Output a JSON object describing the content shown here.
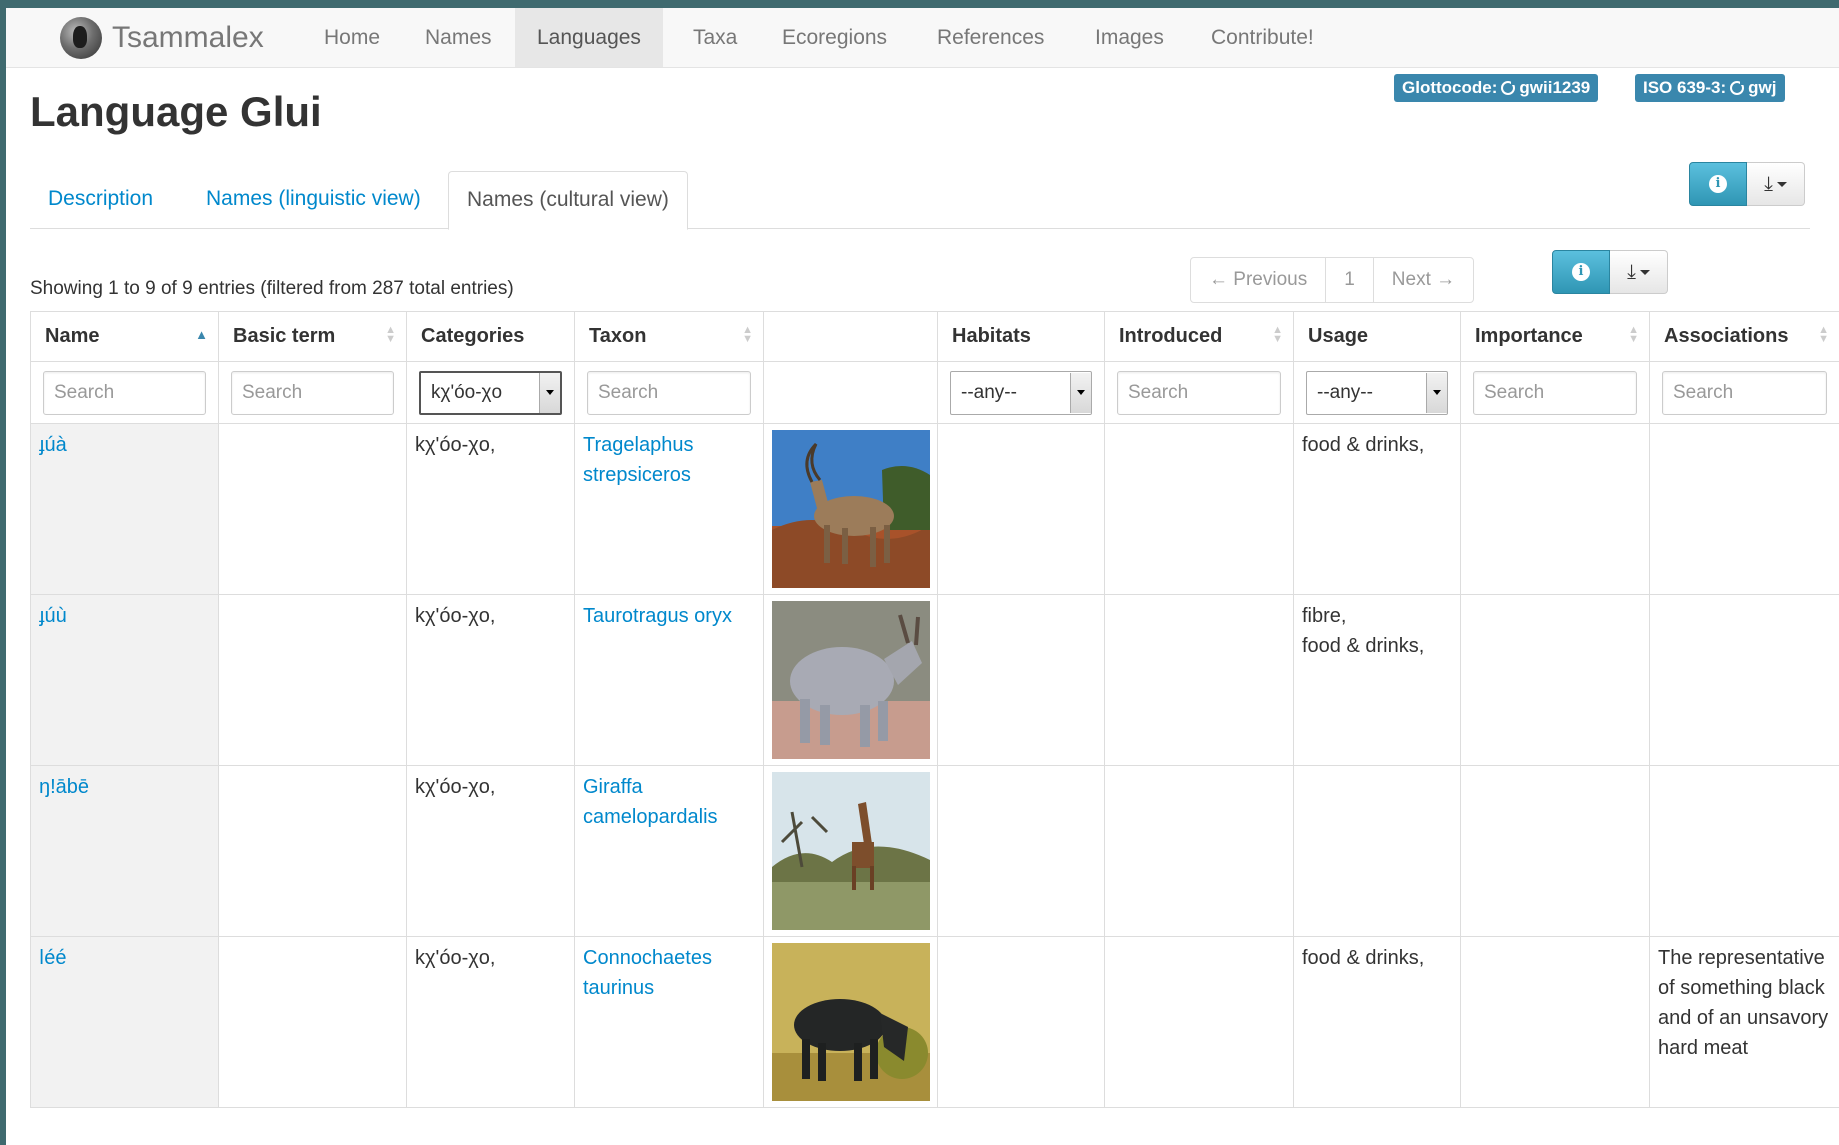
{
  "brand": "Tsammalex",
  "nav": [
    "Home",
    "Names",
    "Languages",
    "Taxa",
    "Ecoregions",
    "References",
    "Images",
    "Contribute!"
  ],
  "page_title": "Language Glui",
  "badges": {
    "glottocode_label": "Glottocode:",
    "glottocode_value": "gwii1239",
    "iso_label": "ISO 639-3:",
    "iso_value": "gwj"
  },
  "tabs": [
    "Description",
    "Names (linguistic view)",
    "Names (cultural view)"
  ],
  "showing": "Showing 1 to 9 of 9 entries (filtered from 287 total entries)",
  "pager": {
    "previous": "← Previous",
    "page": "1",
    "next": "Next →"
  },
  "columns": [
    "Name",
    "Basic term",
    "Categories",
    "Taxon",
    "",
    "Habitats",
    "Introduced",
    "Usage",
    "Importance",
    "Associations"
  ],
  "filters": {
    "search_placeholder": "Search",
    "categories_value": "kχ'óo-χo",
    "any_value": "--any--"
  },
  "rows": [
    {
      "name": "ɟúà",
      "basic": "",
      "categories": "kχ'óo-χo,",
      "taxon": "Tragelaphus strepsiceros",
      "image": "kudu",
      "habitats": "",
      "introduced": "",
      "usage": [
        "food & drinks,"
      ],
      "importance": "",
      "associations": ""
    },
    {
      "name": "ɟúù",
      "basic": "",
      "categories": "kχ'óo-χo,",
      "taxon": "Taurotragus oryx",
      "image": "eland",
      "habitats": "",
      "introduced": "",
      "usage": [
        "fibre,",
        "food & drinks,"
      ],
      "importance": "",
      "associations": ""
    },
    {
      "name": "ŋ!ābē",
      "basic": "",
      "categories": "kχ'óo-χo,",
      "taxon": "Giraffa camelopardalis",
      "image": "giraffe",
      "habitats": "",
      "introduced": "",
      "usage": [],
      "importance": "",
      "associations": ""
    },
    {
      "name": "ǀéé",
      "basic": "",
      "categories": "kχ'óo-χo,",
      "taxon": "Connochaetes taurinus",
      "image": "wildebeest",
      "habitats": "",
      "introduced": "",
      "usage": [
        "food & drinks,"
      ],
      "importance": "",
      "associations": "The representative of something black and of an unsavory hard meat"
    }
  ]
}
